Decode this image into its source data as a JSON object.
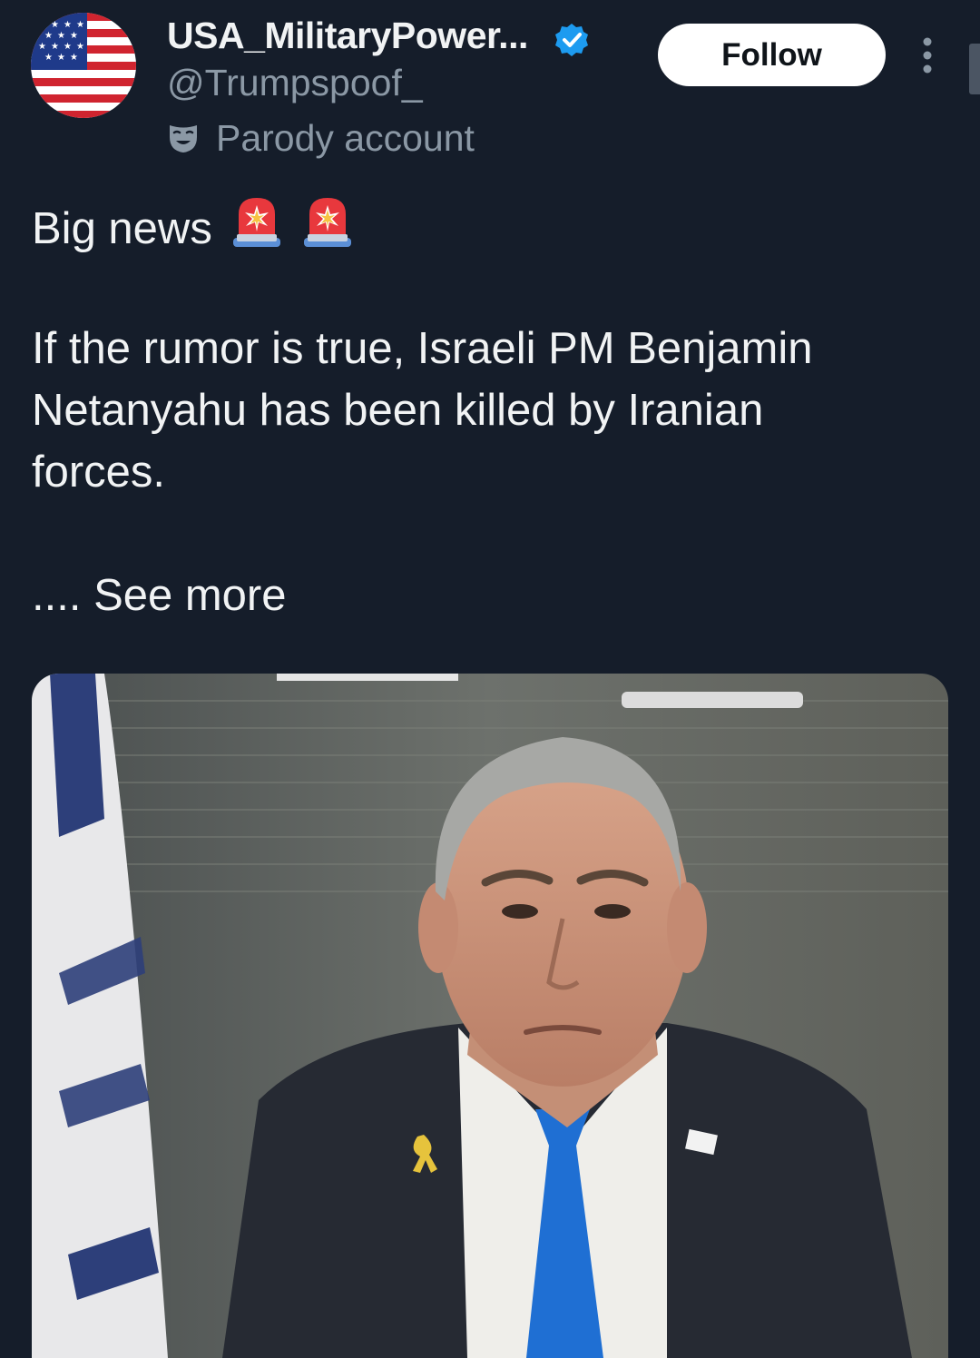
{
  "post": {
    "author": {
      "display_name": "USA_MilitaryPower...",
      "handle": "@Trumpspoof_",
      "verified": true,
      "label": "Parody account",
      "avatar_icon": "us-flag-icon"
    },
    "follow_label": "Follow",
    "more_icon": "more-vertical-icon",
    "text": {
      "headline": "Big news",
      "headline_emoji": [
        "police-light-emoji",
        "police-light-emoji"
      ],
      "line_1": "If the rumor is true, Israeli PM Benjamin",
      "line_2": "Netanyahu has been killed by Iranian",
      "line_3": "forces.",
      "see_more": ".... See more"
    },
    "media": {
      "type": "photo",
      "description_icon": "portrait-photo"
    }
  },
  "colors": {
    "background": "#151d2a",
    "text_primary": "#f1f3f4",
    "text_secondary": "#8b98a5",
    "verified_blue": "#1d9bf0",
    "follow_bg": "#ffffff",
    "follow_text": "#0f1419"
  }
}
